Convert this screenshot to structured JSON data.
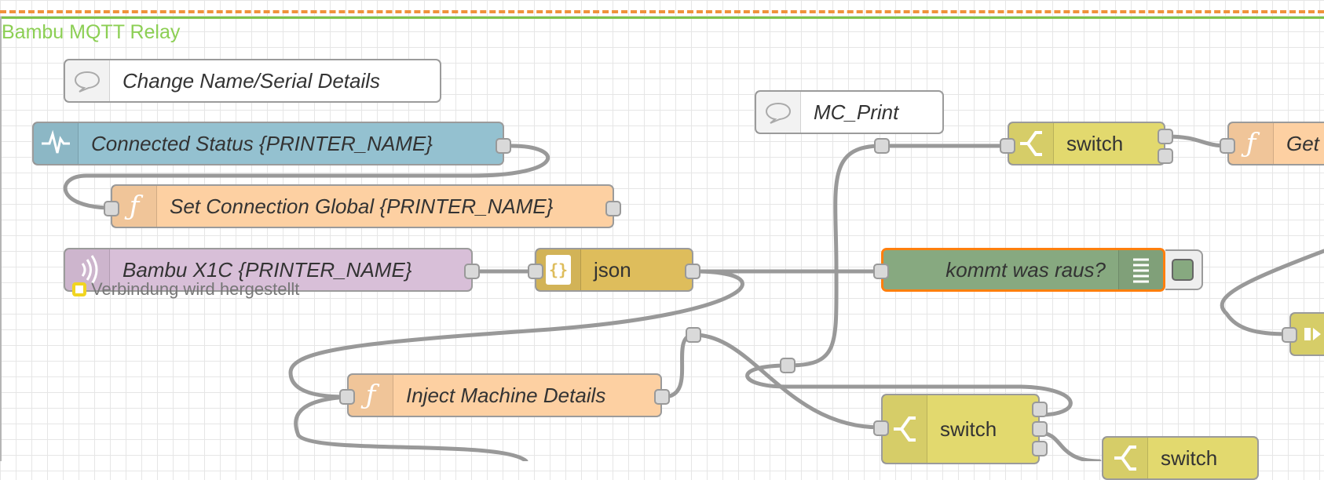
{
  "group": {
    "label": "Bambu MQTT Relay"
  },
  "nodes": {
    "comment_change_name": {
      "label": "Change Name/Serial Details",
      "icon": "comment-icon",
      "color": "#ffffff"
    },
    "comment_mc_print": {
      "label": "MC_Print",
      "icon": "comment-icon",
      "color": "#ffffff"
    },
    "status_connected": {
      "label": "Connected Status {PRINTER_NAME}",
      "icon": "status-pulse-icon",
      "color": "#94c1d0"
    },
    "function_set_connection": {
      "label": "Set Connection Global {PRINTER_NAME}",
      "icon": "function-icon",
      "color": "#fdd0a2"
    },
    "mqtt_in_bambu": {
      "label": "Bambu X1C {PRINTER_NAME}",
      "icon": "mqtt-broadcast-icon",
      "color": "#d8bfd8"
    },
    "json_parse": {
      "label": "json",
      "icon": "json-icon",
      "color": "#debd5c"
    },
    "debug_kommt": {
      "label": "kommt was raus?",
      "icon": "debug-list-icon",
      "color": "#87a980"
    },
    "switch_top": {
      "label": "switch",
      "icon": "switch-icon",
      "color": "#e2d96e"
    },
    "function_get": {
      "label": "Get",
      "icon": "function-icon",
      "color": "#fdd0a2"
    },
    "function_inject_machine": {
      "label": "Inject Machine Details",
      "icon": "function-icon",
      "color": "#fdd0a2"
    },
    "switch_middle": {
      "label": "switch",
      "icon": "switch-icon",
      "color": "#e2d96e"
    },
    "switch_bottom": {
      "label": "switch",
      "icon": "switch-icon",
      "color": "#e2d96e"
    }
  },
  "status": {
    "mqtt_in_bambu": "Verbindung wird hergestellt"
  },
  "colors": {
    "wire": "#999999",
    "group_border": "#7fc24a",
    "group_dash": "#f0923b",
    "selected": "#ff7f0e"
  }
}
